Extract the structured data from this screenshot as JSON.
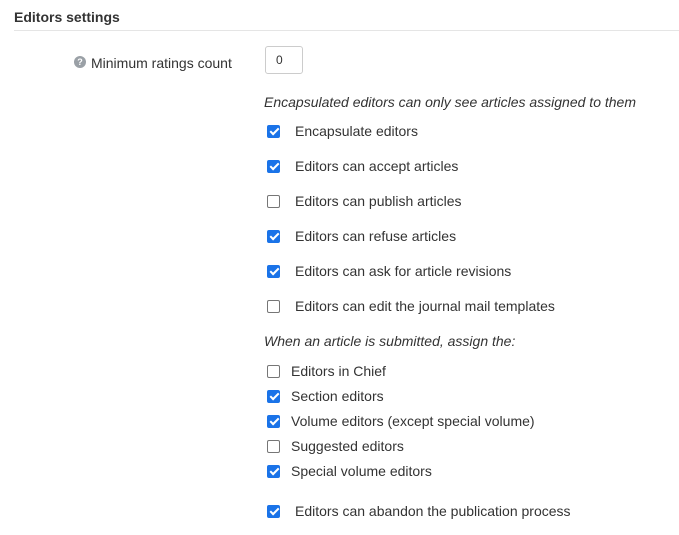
{
  "section": {
    "title": "Editors settings"
  },
  "min_ratings": {
    "label": "Minimum ratings count",
    "value": "0",
    "help_icon": "question-circle-icon"
  },
  "encapsulation_note": "Encapsulated editors can only see articles assigned to them",
  "permissions": [
    {
      "label": "Encapsulate editors",
      "checked": true
    },
    {
      "label": "Editors can accept articles",
      "checked": true
    },
    {
      "label": "Editors can publish articles",
      "checked": false
    },
    {
      "label": "Editors can refuse articles",
      "checked": true
    },
    {
      "label": "Editors can ask for article revisions",
      "checked": true
    },
    {
      "label": "Editors can edit the journal mail templates",
      "checked": false
    }
  ],
  "assign_note": "When an article is submitted, assign the:",
  "assign_options": [
    {
      "label": "Editors in Chief",
      "checked": false
    },
    {
      "label": "Section editors",
      "checked": true
    },
    {
      "label": "Volume editors (except special volume)",
      "checked": true
    },
    {
      "label": "Suggested editors",
      "checked": false
    },
    {
      "label": "Special volume editors",
      "checked": true
    }
  ],
  "abandon": {
    "label": "Editors can abandon the publication process",
    "checked": true
  },
  "colors": {
    "checkbox_checked": "#1a73e8",
    "text": "#333333",
    "help_icon": "#9aa0a6"
  }
}
